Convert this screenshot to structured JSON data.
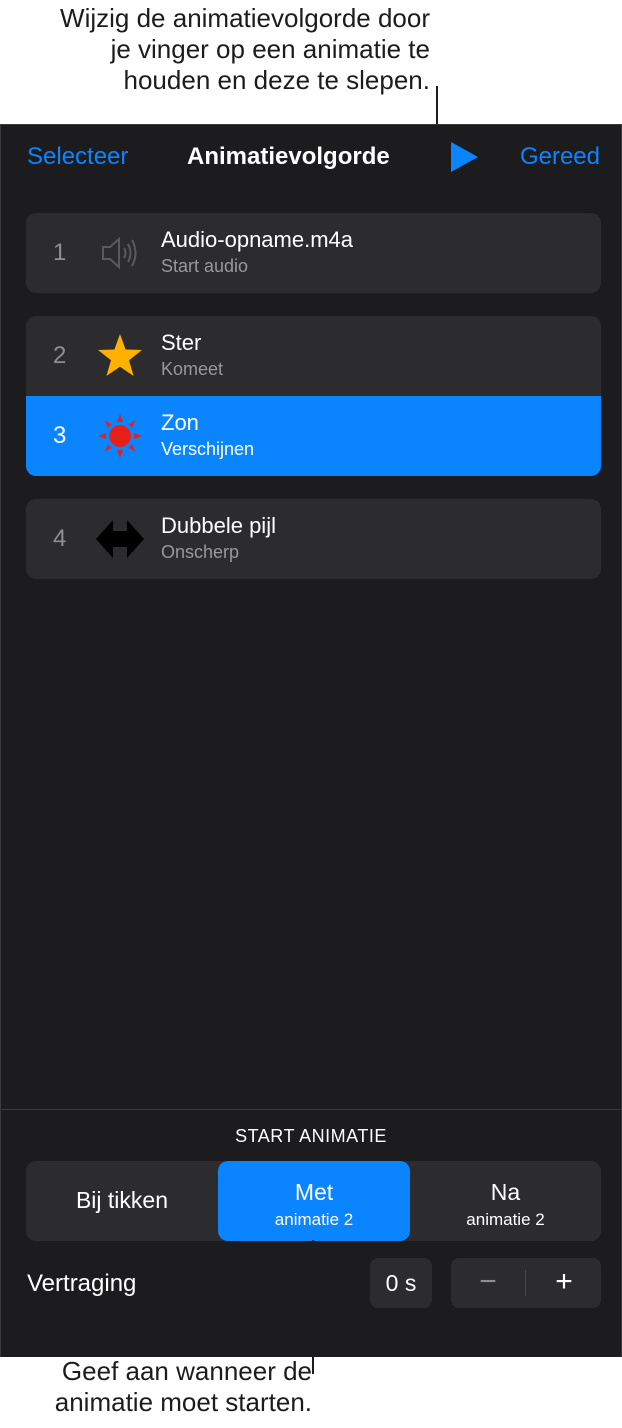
{
  "callouts": {
    "top": "Wijzig de animatievolgorde door\nje vinger op een animatie te\nhouden en deze te slepen.",
    "bottom": "Geef aan wanneer de\nanimatie moet starten."
  },
  "nav": {
    "left": "Selecteer",
    "title": "Animatievolgorde",
    "play_icon": "play-icon",
    "right": "Gereed"
  },
  "animations": [
    {
      "number": "1",
      "name": "Audio-opname.m4a",
      "effect": "Start audio",
      "icon": "speaker-icon"
    },
    {
      "number": "2",
      "name": "Ster",
      "effect": "Komeet",
      "icon": "star-icon"
    },
    {
      "number": "3",
      "name": "Zon",
      "effect": "Verschijnen",
      "icon": "sun-icon",
      "selected": true
    },
    {
      "number": "4",
      "name": "Dubbele pijl",
      "effect": "Onscherp",
      "icon": "double-arrow-icon"
    }
  ],
  "start": {
    "section_label": "START ANIMATIE",
    "options": [
      {
        "label": "Bij tikken",
        "sub": ""
      },
      {
        "label": "Met",
        "sub": "animatie 2",
        "selected": true
      },
      {
        "label": "Na",
        "sub": "animatie 2"
      }
    ]
  },
  "delay": {
    "label": "Vertraging",
    "value": "0 s",
    "minus": "−",
    "plus": "+"
  },
  "colors": {
    "accent": "#0a84ff",
    "panel_bg": "#1c1c1e",
    "row_bg": "#2c2c2e",
    "star": "#ffb000",
    "sun": "#e8201a"
  }
}
